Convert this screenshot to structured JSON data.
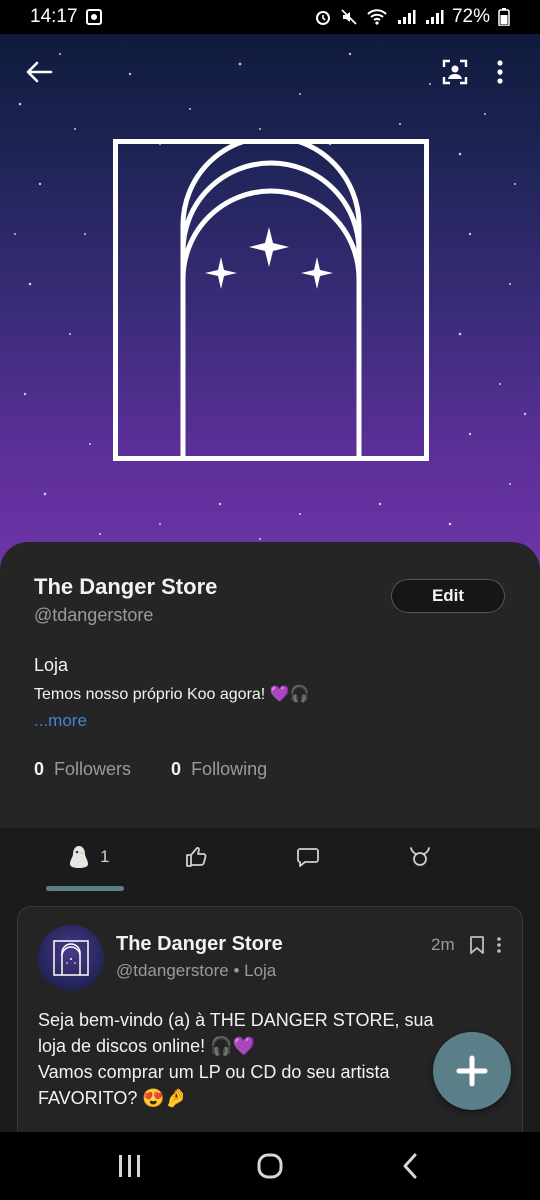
{
  "status_bar": {
    "time": "14:17",
    "battery": "72%",
    "icons": [
      "alarm-icon",
      "mute-icon",
      "wifi-icon",
      "signal-icon",
      "signal-icon",
      "battery-icon"
    ]
  },
  "header": {
    "back_icon": "back-arrow-icon",
    "profile_icon": "profile-qr-icon",
    "menu_icon": "more-vertical-icon"
  },
  "profile": {
    "name": "The Danger Store",
    "handle": "@tdangerstore",
    "edit_label": "Edit",
    "bio_title": "Loja",
    "bio_text": "Temos nosso próprio Koo agora! 💜🎧",
    "more_label": "...more",
    "followers_count": "0",
    "followers_label": "Followers",
    "following_count": "0",
    "following_label": "Following"
  },
  "tabs": [
    {
      "icon": "koo-bird-icon",
      "count": "1",
      "active": true
    },
    {
      "icon": "thumbs-up-icon",
      "count": ""
    },
    {
      "icon": "comment-icon",
      "count": ""
    },
    {
      "icon": "rekoo-icon",
      "count": ""
    }
  ],
  "post": {
    "name": "The Danger Store",
    "handle": "@tdangerstore",
    "meta_separator": " • ",
    "category": "Loja",
    "time": "2m",
    "line1": "Seja bem-vindo (a) à THE DANGER STORE, sua",
    "line2": "loja de discos online! 🎧💜",
    "line3": "Vamos comprar um LP ou CD do seu artista",
    "line4": "FAVORITO? 😍🤌"
  },
  "fab_icon": "plus-icon",
  "nav": {
    "icons": [
      "recents-icon",
      "home-icon",
      "back-icon"
    ]
  }
}
